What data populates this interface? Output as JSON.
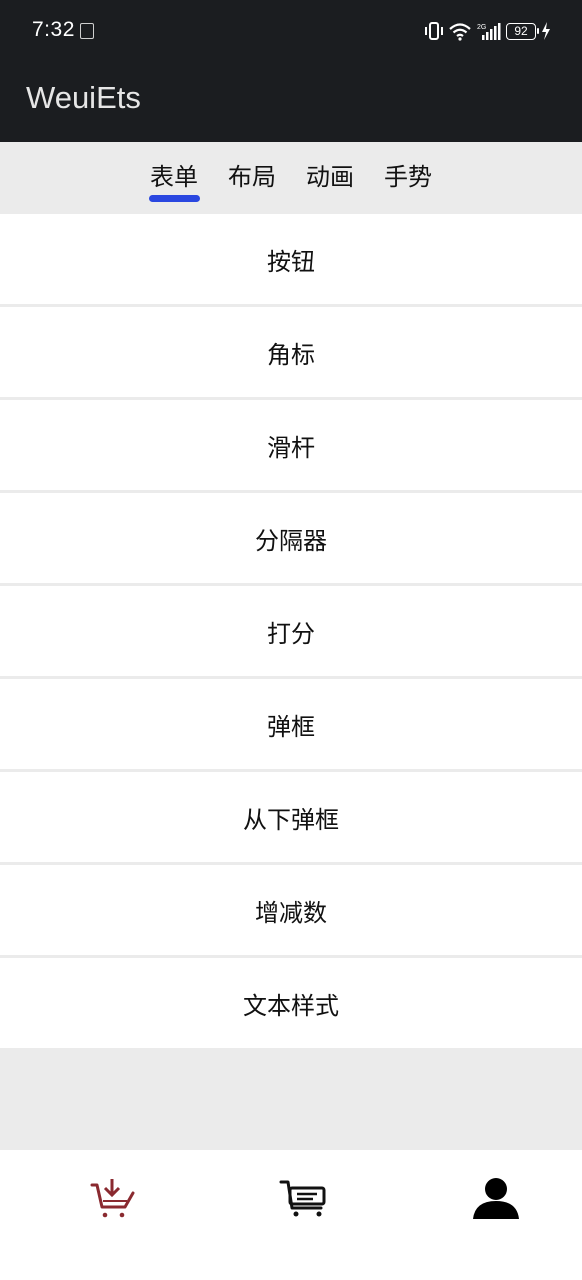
{
  "status_bar": {
    "time": "7:32",
    "sim_label": "SIM",
    "battery_level": "92",
    "icons": [
      "vibrate-icon",
      "wifi-icon",
      "signal-icon",
      "battery-icon",
      "charging-icon"
    ]
  },
  "app": {
    "title": "WeuiEts"
  },
  "tabs": [
    {
      "label": "表单",
      "active": true
    },
    {
      "label": "布局",
      "active": false
    },
    {
      "label": "动画",
      "active": false
    },
    {
      "label": "手势",
      "active": false
    }
  ],
  "menu": [
    {
      "label": "按钮"
    },
    {
      "label": "角标"
    },
    {
      "label": "滑杆"
    },
    {
      "label": "分隔器"
    },
    {
      "label": "打分"
    },
    {
      "label": "弹框"
    },
    {
      "label": "从下弹框"
    },
    {
      "label": "增减数"
    },
    {
      "label": "文本样式"
    }
  ],
  "bottom_nav": [
    {
      "icon": "basket-download-icon",
      "active": true
    },
    {
      "icon": "cart-icon",
      "active": false
    },
    {
      "icon": "user-icon",
      "active": false
    }
  ],
  "colors": {
    "app_bar": "#1b1d20",
    "accent": "#2a47e0",
    "active_nav": "#8a2a30",
    "background": "#ebebeb"
  }
}
